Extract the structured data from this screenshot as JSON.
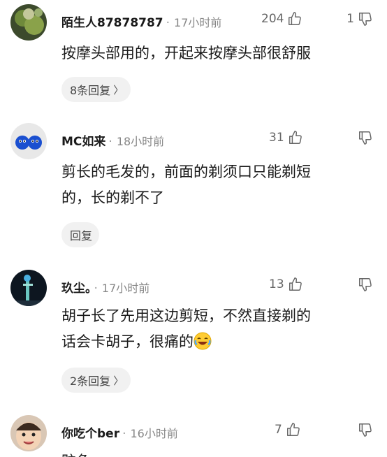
{
  "comments": [
    {
      "username": "陌生人87878787",
      "time": "17小时前",
      "likes": "204",
      "dislikes": "1",
      "text": "按摩头部用的，开起来按摩头部很舒服",
      "reply_label": "8条回复"
    },
    {
      "username": "MC如来",
      "time": "18小时前",
      "likes": "31",
      "dislikes": "",
      "text_line1": "剪长的毛发的，前面的剃须口只能剃短",
      "text_line2": "的，长的剃不了",
      "reply_label": "回复"
    },
    {
      "username": "玖尘。",
      "time": "17小时前",
      "likes": "13",
      "dislikes": "",
      "text_line1": "胡子长了先用这边剪短，不然直接剃的",
      "text_line2": "话会卡胡子，很痛的",
      "reply_label": "2条回复"
    },
    {
      "username": "你吃个ber",
      "time": "16小时前",
      "likes": "7",
      "dislikes": "",
      "text_partial": "贮色"
    }
  ],
  "icons": {
    "like": "thumbs-up-icon",
    "dislike": "thumbs-down-icon",
    "chevron": "chevron-right-icon",
    "emoji": "laughing-crying-emoji-icon"
  },
  "colors": {
    "background": "#ffffff",
    "pill": "#f1f1f1",
    "meta": "#888888"
  }
}
